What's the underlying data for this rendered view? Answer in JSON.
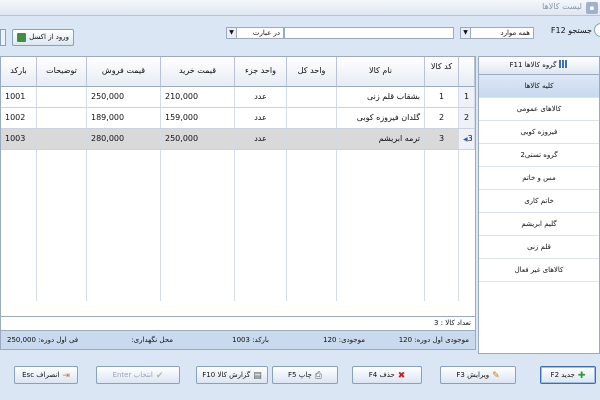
{
  "window": {
    "title": "لیست کالاها"
  },
  "toolbar": {
    "search_label": "جستجو F12",
    "field_select": "همه موارد",
    "mode_select": "در عبارت",
    "search_value": "",
    "excel_button": "ورود از اکسل"
  },
  "grid": {
    "columns": {
      "row": "",
      "code": "کد کالا",
      "name": "نام کالا",
      "unit_main": "واحد کل",
      "unit_part": "واحد جزء",
      "buy_price": "قیمت خرید",
      "sell_price": "قیمت فروش",
      "description": "توضیحات",
      "barcode": "بارکد"
    },
    "rows": [
      {
        "row": "1",
        "code": "1",
        "name": "بشقاب قلم زنی",
        "unit_main": "",
        "unit_part": "عدد",
        "buy_price": "210,000",
        "sell_price": "250,000",
        "description": "",
        "barcode": "1001"
      },
      {
        "row": "2",
        "code": "2",
        "name": "گلدان فیروزه کوبی",
        "unit_main": "",
        "unit_part": "عدد",
        "buy_price": "159,000",
        "sell_price": "189,000",
        "description": "",
        "barcode": "1002"
      },
      {
        "row": "3",
        "code": "3",
        "name": "ترمه ابریشم",
        "unit_main": "",
        "unit_part": "عدد",
        "buy_price": "250,000",
        "sell_price": "280,000",
        "description": "",
        "barcode": "1003"
      }
    ],
    "count_label": "تعداد کالا : 3"
  },
  "info": {
    "opening_stock": "موجودی اول دوره: 120",
    "stock": "موجودی: 120",
    "barcode": "بارکد: 1003",
    "location": "محل نگهداری:",
    "opening_price": "فی اول دوره: 250,000"
  },
  "sidebar": {
    "header": "گروه کالاها F11",
    "items": [
      "کلیه کالاها",
      "کالاهای عمومی",
      "فیروزه کوبی",
      "گروه تستی2",
      "مس و خاتم",
      "خاتم کاری",
      "گلیم ابریشم",
      "قلم زنی",
      "کالاهای غیر فعال"
    ]
  },
  "footer": {
    "new": "جدید F2",
    "edit": "ویرایش F3",
    "delete": "حذف F4",
    "print": "چاپ F5",
    "report": "گزارش کالا F10",
    "select": "انتخاب Enter",
    "cancel": "انصراف Esc"
  },
  "colors": {
    "accent": "#3a6fb0",
    "selected_row": "#d9d9d9",
    "background": "#dbe6f4"
  }
}
